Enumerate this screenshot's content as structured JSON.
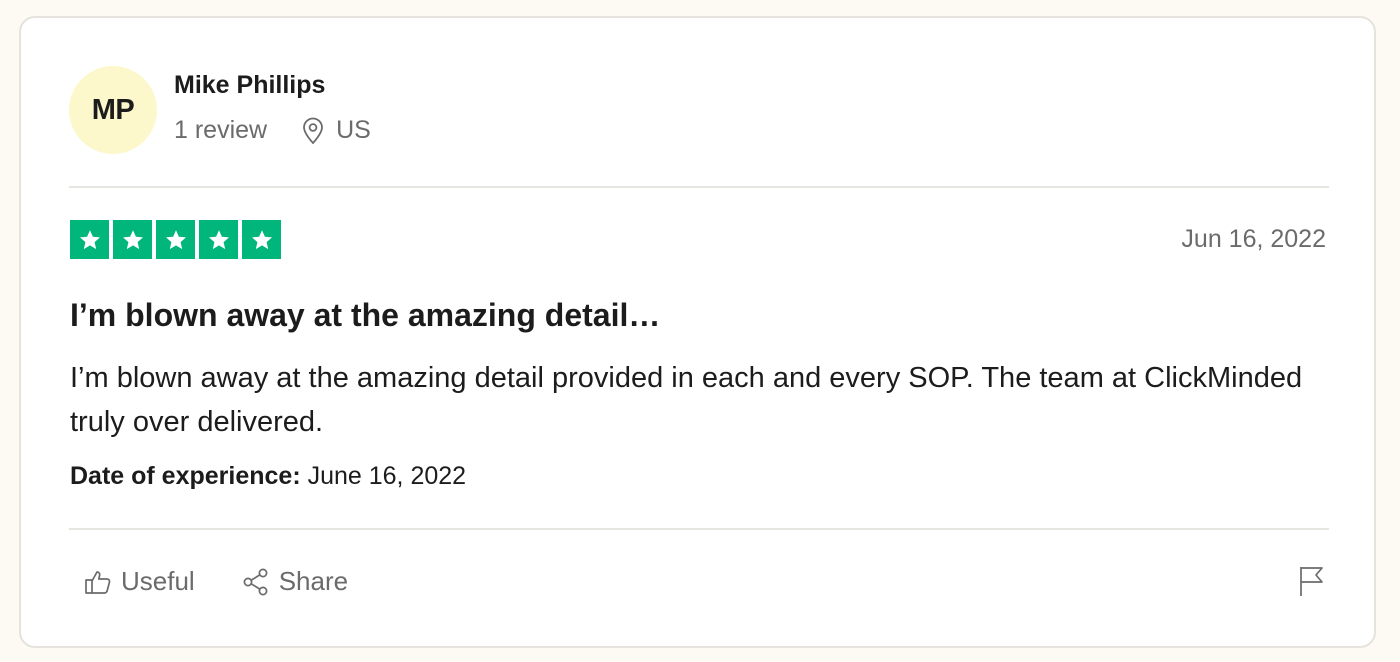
{
  "reviewer": {
    "initials": "MP",
    "name": "Mike Phillips",
    "review_count": "1 review",
    "location": "US"
  },
  "review": {
    "rating": 5,
    "max_rating": 5,
    "date": "Jun 16, 2022",
    "title": "I’m blown away at the amazing detail…",
    "body": "I’m blown away at the amazing detail provided in each and every SOP. The team at ClickMinded truly over delivered.",
    "experience_label": "Date of experience:",
    "experience_date": "June 16, 2022"
  },
  "actions": {
    "useful_label": "Useful",
    "share_label": "Share"
  },
  "icons": {
    "location": "location-pin-icon",
    "useful": "thumbs-up-icon",
    "share": "share-icon",
    "report": "flag-icon"
  },
  "colors": {
    "star_bg": "#00b67a",
    "avatar_bg": "#fcf8cc",
    "muted_text": "#6b6b6b",
    "page_bg": "#fcfaf3"
  }
}
